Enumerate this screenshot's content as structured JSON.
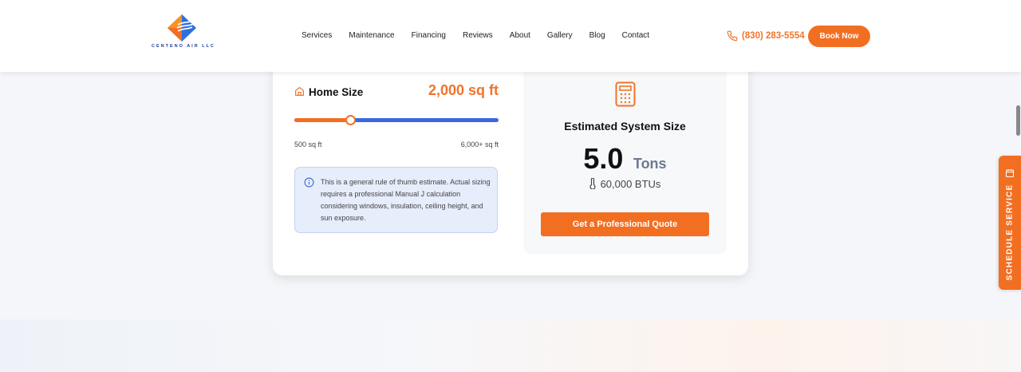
{
  "header": {
    "logo_text": "CENTENO AIR LLC",
    "nav": [
      "Services",
      "Maintenance",
      "Financing",
      "Reviews",
      "About",
      "Gallery",
      "Blog",
      "Contact"
    ],
    "phone": "(830) 283-5554",
    "book_button": "Book Now"
  },
  "calculator": {
    "home_size_label": "Home Size",
    "home_size_value": "2,000 sq ft",
    "slider": {
      "min": 500,
      "max": 6000,
      "value": 2000
    },
    "range_min_label": "500 sq ft",
    "range_max_label": "6,000+ sq ft",
    "info_text": "This is a general rule of thumb estimate. Actual sizing requires a professional Manual J calculation considering windows, insulation, ceiling height, and sun exposure.",
    "result_title": "Estimated System Size",
    "tons_value": "5.0",
    "tons_unit": "Tons",
    "btu_value": "60,000 BTUs",
    "quote_button": "Get a Professional Quote"
  },
  "schedule_tab": {
    "label": "SCHEDULE SERVICE"
  },
  "colors": {
    "accent": "#f26f22",
    "slider_track": "#3b67e0",
    "info_bg": "#e6edfb"
  }
}
